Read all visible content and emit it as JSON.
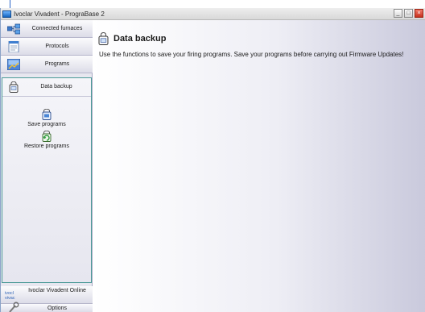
{
  "window": {
    "title": "Ivoclar Vivadent - PrograBase 2",
    "buttons": {
      "minimize": "_",
      "restore": "□",
      "close": "×"
    }
  },
  "sidebar": {
    "items": [
      {
        "label": "Connected furnaces",
        "icon": "furnaces-icon"
      },
      {
        "label": "Protocols",
        "icon": "protocols-icon"
      },
      {
        "label": "Programs",
        "icon": "programs-icon"
      }
    ],
    "active_panel": {
      "label": "Data backup",
      "icon": "data-backup-icon",
      "actions": [
        {
          "label": "Save programs",
          "icon": "save-programs-icon"
        },
        {
          "label": "Restore programs",
          "icon": "restore-programs-icon"
        }
      ]
    },
    "bottom_items": [
      {
        "label": "Ivoclar Vivadent Online",
        "icon": "ivoclar-logo"
      },
      {
        "label": "Options",
        "icon": "tools-icon"
      }
    ]
  },
  "main": {
    "title": "Data backup",
    "description": "Use the functions to save your firing programs. Save your programs before carrying out Firmware Updates!"
  },
  "colors": {
    "panel_border": "#4b9a97",
    "sidebar_bg": "#e7e7ef",
    "main_gradient_end": "#c9c9dc"
  }
}
